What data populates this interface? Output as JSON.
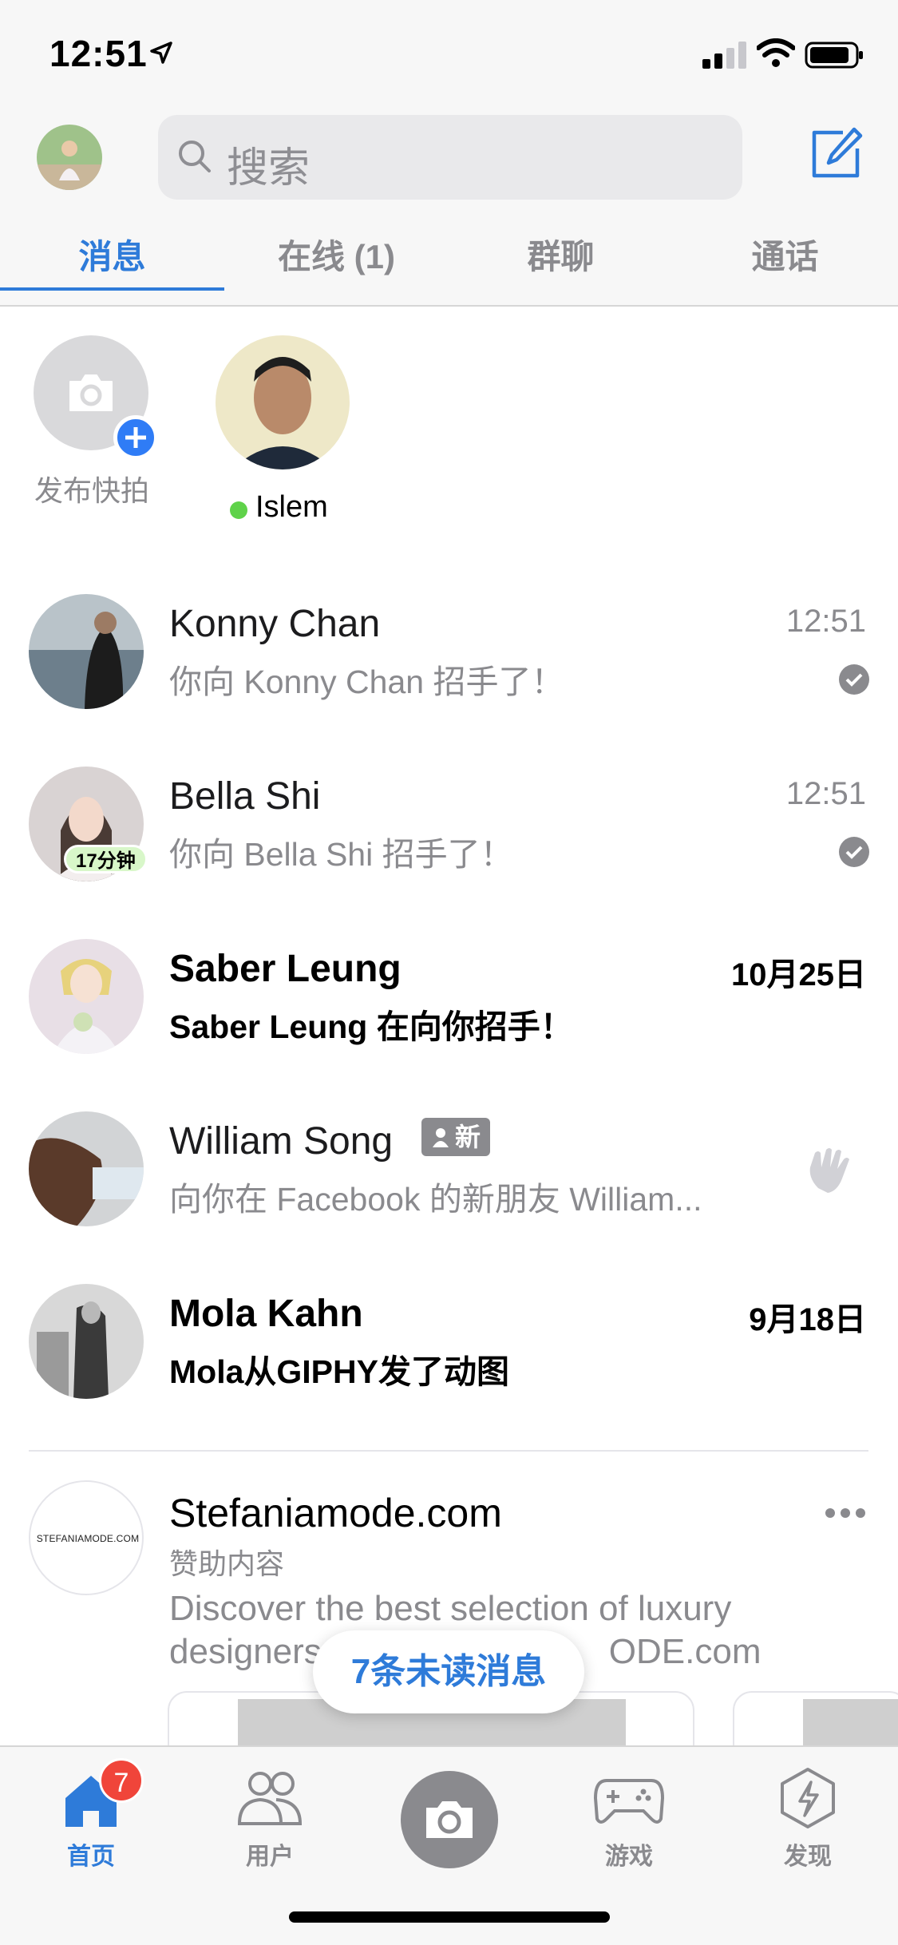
{
  "status_bar": {
    "time": "12:51"
  },
  "header": {
    "search_placeholder": "搜索",
    "tabs": [
      {
        "label": "消息",
        "active": true
      },
      {
        "label": "在线 (1)",
        "active": false
      },
      {
        "label": "群聊",
        "active": false
      },
      {
        "label": "通话",
        "active": false
      }
    ]
  },
  "stories": {
    "add_label": "发布快拍",
    "users": [
      {
        "name": "Islem",
        "online": true
      }
    ]
  },
  "conversations": [
    {
      "name": "Konny Chan",
      "preview": "你向 Konny Chan 招手了！",
      "time": "12:51",
      "unread": false,
      "status": "read"
    },
    {
      "name": "Bella Shi",
      "preview": "你向 Bella Shi 招手了！",
      "time": "12:51",
      "unread": false,
      "status": "read",
      "avatar_badge": "17分钟"
    },
    {
      "name": "Saber Leung",
      "preview": "Saber Leung 在向你招手！",
      "time": "10月25日",
      "unread": true
    },
    {
      "name": "William Song",
      "preview": "向你在 Facebook 的新朋友 William...",
      "new_badge": "新",
      "action": "wave"
    },
    {
      "name": "Mola Kahn",
      "preview": "Mola从GIPHY发了动图",
      "time": "9月18日",
      "unread": true
    }
  ],
  "sponsored": {
    "name": "Stefaniamode.com",
    "logo_text": "STEFANIAMODE.COM",
    "label": "赞助内容",
    "description_line1": "Discover the best selection of luxury",
    "description_line2": "designers",
    "description_line2_tail": "ODE.com"
  },
  "unread_pill": "7条未读消息",
  "tabbar": {
    "items": [
      {
        "label": "首页",
        "active": true,
        "badge": "7"
      },
      {
        "label": "用户",
        "active": false
      },
      {
        "label": "",
        "active": false
      },
      {
        "label": "游戏",
        "active": false
      },
      {
        "label": "发现",
        "active": false
      }
    ]
  },
  "colors": {
    "accent": "#2e7bd9",
    "badge": "#f0453a",
    "online": "#5fd24a"
  }
}
